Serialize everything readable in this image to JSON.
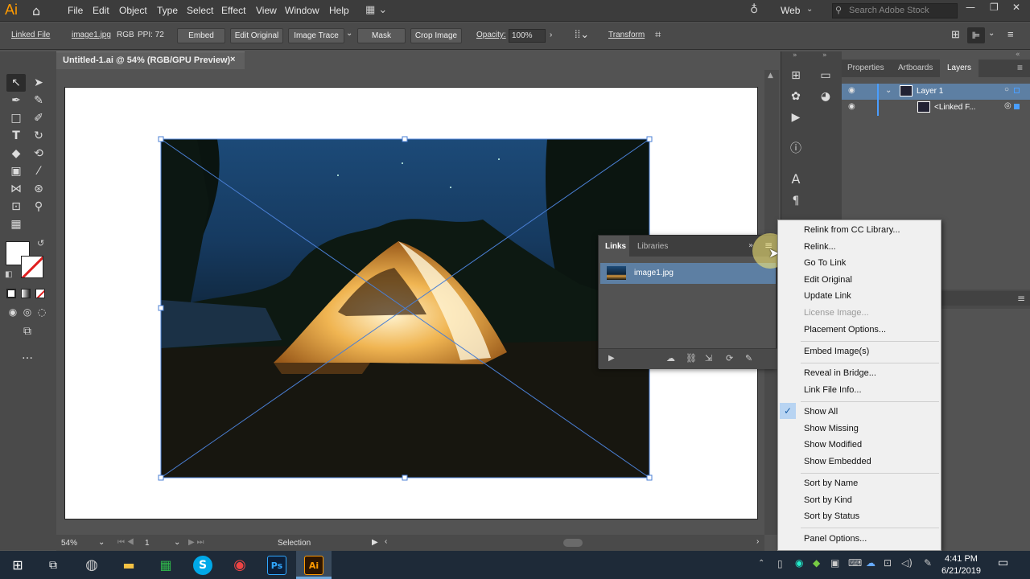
{
  "app": {
    "logo": "Ai",
    "workspace": "Web",
    "search_placeholder": "Search Adobe Stock"
  },
  "menu": [
    "File",
    "Edit",
    "Object",
    "Type",
    "Select",
    "Effect",
    "View",
    "Window",
    "Help"
  ],
  "control_bar": {
    "type": "Linked File",
    "filename": "image1.jpg",
    "color_mode": "RGB",
    "ppi": "PPI: 72",
    "embed": "Embed",
    "edit_original": "Edit Original",
    "image_trace": "Image Trace",
    "mask": "Mask",
    "crop_image": "Crop Image",
    "opacity_label": "Opacity:",
    "opacity_value": "100%",
    "transform": "Transform"
  },
  "document": {
    "tab_title": "Untitled-1.ai @ 54% (RGB/GPU Preview)",
    "close": "×"
  },
  "status": {
    "zoom": "54%",
    "artboard": "1",
    "tool": "Selection"
  },
  "layers_panel": {
    "tabs": [
      "Properties",
      "Artboards",
      "Layers"
    ],
    "active_tab": "Layers",
    "rows": [
      {
        "name": "Layer 1"
      },
      {
        "name": "<Linked F..."
      }
    ]
  },
  "links_panel": {
    "tabs": [
      "Links",
      "Libraries"
    ],
    "item": "image1.jpg"
  },
  "context_menu": {
    "items": [
      {
        "label": "Relink from CC Library...",
        "disabled": false
      },
      {
        "label": "Relink...",
        "disabled": false
      },
      {
        "label": "Go To Link",
        "disabled": false
      },
      {
        "label": "Edit Original",
        "disabled": false
      },
      {
        "label": "Update Link",
        "disabled": false
      },
      {
        "label": "License Image...",
        "disabled": true
      },
      {
        "label": "Placement Options...",
        "disabled": false
      },
      {
        "label": "Embed Image(s)",
        "disabled": false
      },
      {
        "label": "Reveal in Bridge...",
        "disabled": false
      },
      {
        "label": "Link File Info...",
        "disabled": false
      },
      {
        "label": "Show All",
        "disabled": false,
        "checked": true
      },
      {
        "label": "Show Missing",
        "disabled": false
      },
      {
        "label": "Show Modified",
        "disabled": false
      },
      {
        "label": "Show Embedded",
        "disabled": false
      },
      {
        "label": "Sort by Name",
        "disabled": false
      },
      {
        "label": "Sort by Kind",
        "disabled": false
      },
      {
        "label": "Sort by Status",
        "disabled": false
      },
      {
        "label": "Panel Options...",
        "disabled": false
      }
    ]
  },
  "taskbar": {
    "time": "4:41 PM",
    "date": "6/21/2019"
  },
  "colors": {
    "accent": "#5d7fa3",
    "ai_orange": "#ff9a00",
    "selection_blue": "#4a7fd4"
  }
}
